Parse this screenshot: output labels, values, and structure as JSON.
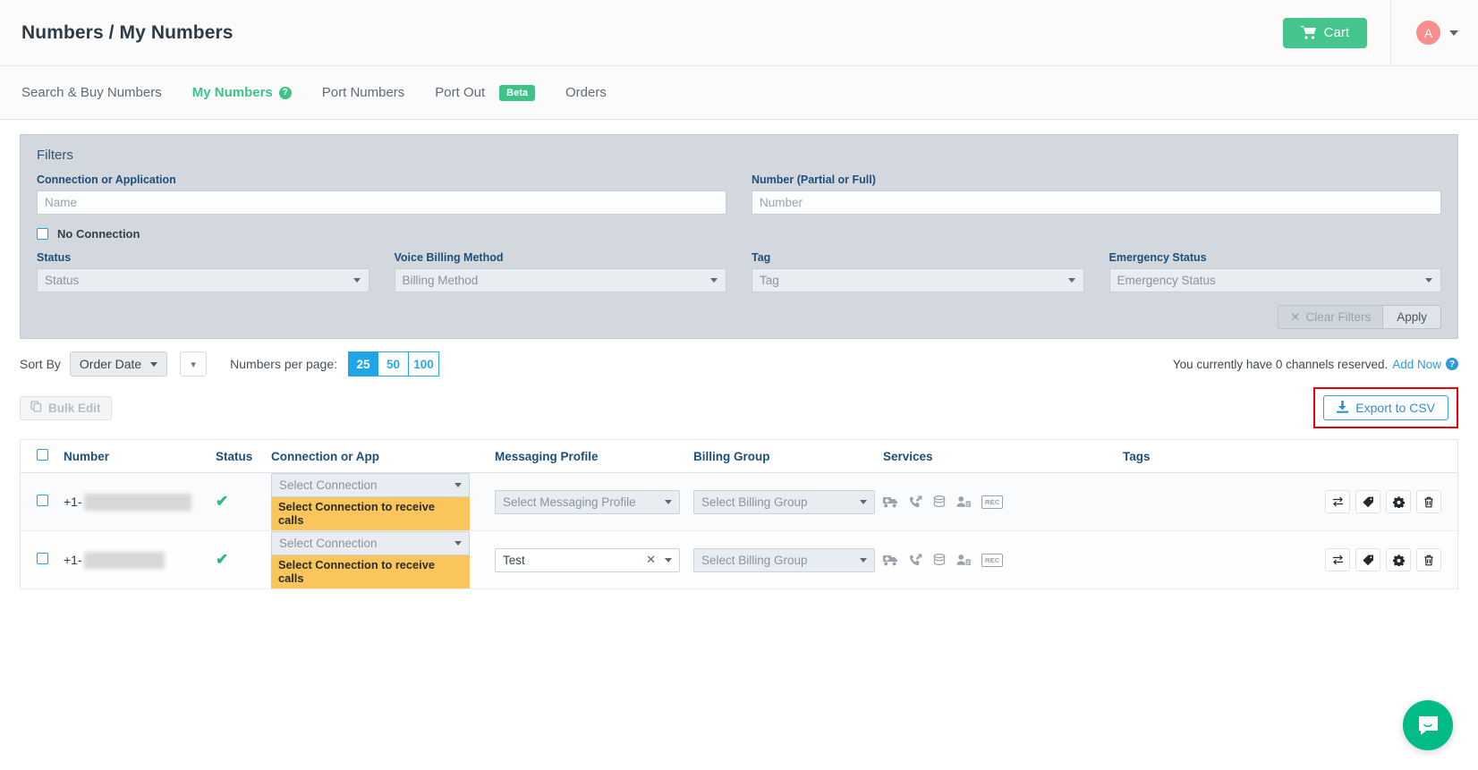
{
  "header": {
    "title": "Numbers / My Numbers",
    "cart_label": "Cart",
    "cart_icon": "shopping-cart-icon",
    "avatar_initial": "A",
    "avatar_caret_icon": "chevron-down-icon"
  },
  "nav": {
    "items": [
      {
        "label": "Search & Buy Numbers",
        "active": false,
        "help": false,
        "beta": false
      },
      {
        "label": "My Numbers",
        "active": true,
        "help": true,
        "beta": false
      },
      {
        "label": "Port Numbers",
        "active": false,
        "help": false,
        "beta": false
      },
      {
        "label": "Port Out",
        "active": false,
        "help": false,
        "beta": true
      },
      {
        "label": "Orders",
        "active": false,
        "help": false,
        "beta": false
      }
    ],
    "beta_label": "Beta"
  },
  "filters": {
    "title": "Filters",
    "connection_label": "Connection or Application",
    "connection_placeholder": "Name",
    "connection_value": "",
    "number_label": "Number (Partial or Full)",
    "number_placeholder": "Number",
    "number_value": "",
    "no_connection_label": "No Connection",
    "no_connection_checked": false,
    "status_label": "Status",
    "status_value": "Status",
    "voice_billing_label": "Voice Billing Method",
    "voice_billing_value": "Billing Method",
    "tag_label": "Tag",
    "tag_value": "Tag",
    "emergency_label": "Emergency Status",
    "emergency_value": "Emergency Status",
    "clear_filters_label": "Clear Filters",
    "clear_filters_icon": "close-x-icon",
    "apply_label": "Apply"
  },
  "toolbar": {
    "sort_by_label": "Sort By",
    "sort_by_value": "Order Date",
    "sort_direction_icon": "chevron-down-icon",
    "numbers_per_page_label": "Numbers per page:",
    "page_sizes": [
      "25",
      "50",
      "100"
    ],
    "page_size_active": "25",
    "channels_text": "You currently have 0 channels reserved.",
    "channels_link": "Add Now",
    "channels_help_icon": "question-circle-icon",
    "bulk_edit_label": "Bulk Edit",
    "bulk_edit_icon": "copy-icon",
    "export_label": "Export to CSV",
    "export_icon": "download-icon",
    "export_highlight_color": "#ef0000"
  },
  "table": {
    "columns": [
      "Number",
      "Status",
      "Connection or App",
      "Messaging Profile",
      "Billing Group",
      "Services",
      "Tags"
    ],
    "select_all_checked": false,
    "rows": [
      {
        "checked": false,
        "number_prefix": "+1-",
        "number_redacted": true,
        "status_icon": "check-mark-icon",
        "connection_value": "Select Connection",
        "connection_warning": "Select Connection to receive calls",
        "messaging_profile_value": "Select Messaging Profile",
        "messaging_profile_filled": false,
        "billing_group_value": "Select Billing Group",
        "services": [
          "emergency-icon",
          "call-forwarding-icon",
          "cnam-icon",
          "caller-id-icon",
          "call-recording-icon"
        ],
        "tags": "",
        "actions": [
          "transfer-icon",
          "tag-icon",
          "settings-gear-icon",
          "delete-trash-icon"
        ]
      },
      {
        "checked": false,
        "number_prefix": "+1-",
        "number_redacted": true,
        "status_icon": "check-mark-icon",
        "connection_value": "Select Connection",
        "connection_warning": "Select Connection to receive calls",
        "messaging_profile_value": "Test",
        "messaging_profile_filled": true,
        "billing_group_value": "Select Billing Group",
        "services": [
          "emergency-icon",
          "call-forwarding-icon",
          "cnam-icon",
          "caller-id-icon",
          "call-recording-icon"
        ],
        "tags": "",
        "actions": [
          "transfer-icon",
          "tag-icon",
          "settings-gear-icon",
          "delete-trash-icon"
        ]
      }
    ],
    "rec_badge_label": "REC"
  },
  "support": {
    "chat_icon": "intercom-chat-icon",
    "chat_color": "#00bd87"
  },
  "colors": {
    "brand_green": "#44c58b",
    "link_blue": "#2e9bd6",
    "active_blue": "#20a6e8",
    "warning_yellow": "#fac65b",
    "header_navy": "#1f4e79"
  }
}
